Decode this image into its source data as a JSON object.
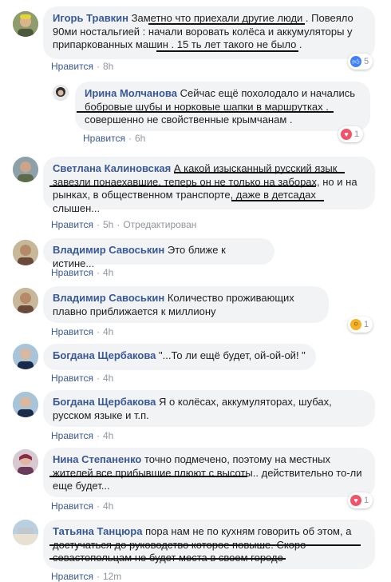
{
  "comments": [
    {
      "author": "Игорь Травкин",
      "text": "Заметно что приехали другие люди . Повеяло 90ми ностальгией : начали воровать колёса и аккумуляторы у припаркованных машин . 15 ть лет такого не было .",
      "like": "Нравится",
      "time": "8h",
      "reaction": {
        "type": "like",
        "count": "5"
      }
    },
    {
      "author": "Ирина Молчанова",
      "text": "Сейчас ещё похолодало и начались бобровые шубы и норковые шапки в маршрутках . совершенно не свойственные крымчанам .",
      "like": "Нравится",
      "time": "6h",
      "reaction": {
        "type": "love",
        "count": "1"
      }
    },
    {
      "author": "Светлана Калиновская",
      "text": "А какой изысканный русский язык завезли понаехавшие, теперь он не только на заборах, но и на рынках, в общественном транспорте, даже в детсадах слышен...",
      "like": "Нравится",
      "time": "5h",
      "edited": "Отредактирован"
    },
    {
      "author": "Владимир Савоськин",
      "text": "Это ближе к истине...",
      "like": "Нравится",
      "time": "4h"
    },
    {
      "author": "Владимир Савоськин",
      "text": "Количество проживающих плавно приближается к миллиону",
      "like": "Нравится",
      "time": "4h",
      "reaction": {
        "type": "wow",
        "count": "1"
      }
    },
    {
      "author": "Богдана Щербакова",
      "text": "\"...То ли ещё будет, ой-ой-ой! \"",
      "like": "Нравится",
      "time": "4h"
    },
    {
      "author": "Богдана Щербакова",
      "text": "Я о колёсах, аккумуляторах, шубах, русском языке и т.п.",
      "like": "Нравится",
      "time": "4h"
    },
    {
      "author": "Нина Степаненко",
      "text": "точно подмечено, поэтому на местных жителей все прибывшие плюют с высоты.. действительно то-ли еще будет...",
      "like": "Нравится",
      "time": "4h",
      "reaction": {
        "type": "love",
        "count": "1"
      }
    },
    {
      "author": "Татьяна Танцюра",
      "text": "пора нам не по кухням говорить об этом, а достучаться до руководство которое повыше. Скоро севастопольцам не будет места в своем городе",
      "like": "Нравится",
      "time": "12m"
    }
  ],
  "separator": "·",
  "colors": {
    "author": "#385898",
    "bubble": "#f2f3f5",
    "meta": "#90949c",
    "like_reaction": "#4080ff",
    "love_reaction": "#f25268",
    "wow_reaction": "#f7b125"
  }
}
